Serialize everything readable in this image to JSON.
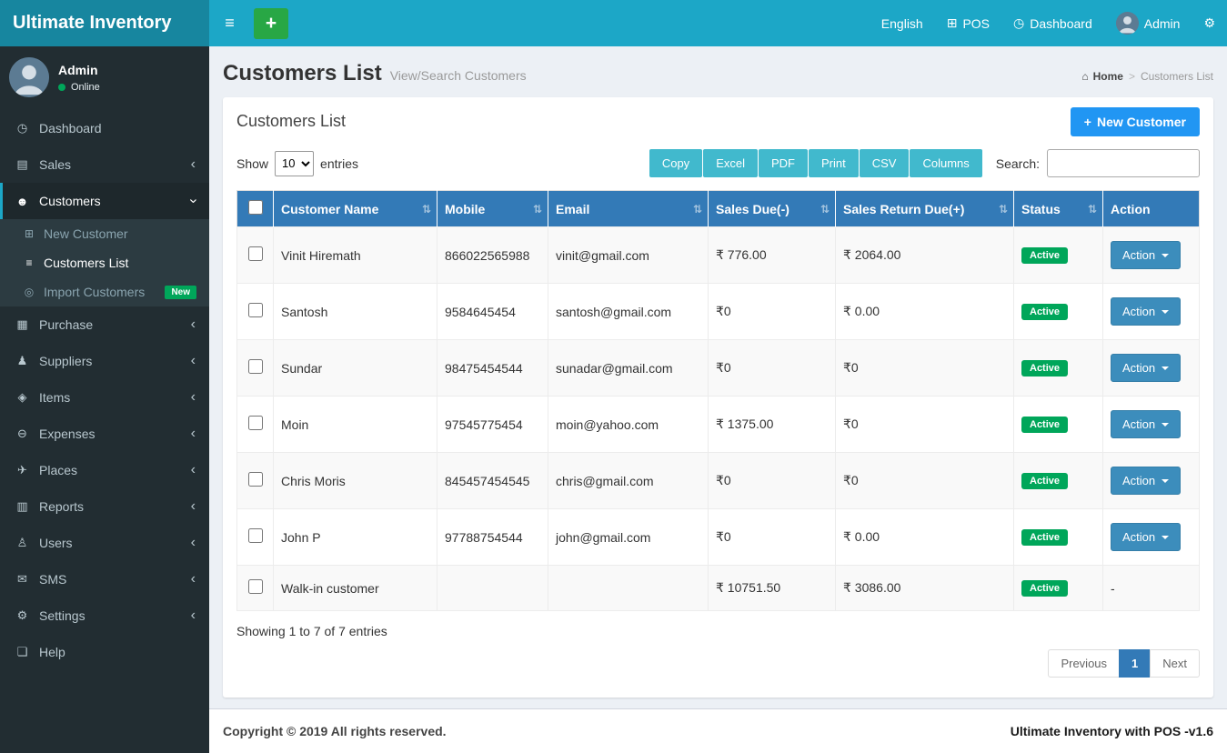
{
  "brand": {
    "title": "Ultimate Inventory"
  },
  "topbar": {
    "language": "English",
    "pos_label": "POS",
    "dashboard_label": "Dashboard",
    "user_name": "Admin",
    "icons": {
      "hamburger": "≡",
      "plus": "+",
      "pos": "⊞",
      "dashboard": "◷",
      "gears": "⚙"
    }
  },
  "sidebar": {
    "user": {
      "name": "Admin",
      "status": "Online"
    },
    "items": [
      {
        "label": "Dashboard",
        "icon": "◷",
        "chevron": ""
      },
      {
        "label": "Sales",
        "icon": "▤",
        "chevron": "‹"
      },
      {
        "label": "Customers",
        "icon": "☻",
        "chevron": "‹"
      },
      {
        "label": "Purchase",
        "icon": "▦",
        "chevron": "‹"
      },
      {
        "label": "Suppliers",
        "icon": "♟",
        "chevron": "‹"
      },
      {
        "label": "Items",
        "icon": "◈",
        "chevron": "‹"
      },
      {
        "label": "Expenses",
        "icon": "⊖",
        "chevron": "‹"
      },
      {
        "label": "Places",
        "icon": "✈",
        "chevron": "‹"
      },
      {
        "label": "Reports",
        "icon": "▥",
        "chevron": "‹"
      },
      {
        "label": "Users",
        "icon": "♙",
        "chevron": "‹"
      },
      {
        "label": "SMS",
        "icon": "✉",
        "chevron": "‹"
      },
      {
        "label": "Settings",
        "icon": "⚙",
        "chevron": "‹"
      },
      {
        "label": "Help",
        "icon": "❏",
        "chevron": ""
      }
    ],
    "customers_submenu": [
      {
        "label": "New Customer",
        "icon": "⊞",
        "badge": ""
      },
      {
        "label": "Customers List",
        "icon": "≡",
        "badge": ""
      },
      {
        "label": "Import Customers",
        "icon": "◎",
        "badge": "New"
      }
    ]
  },
  "page": {
    "title": "Customers List",
    "subtitle": "View/Search Customers",
    "breadcrumb": {
      "home_icon": "⌂",
      "home": "Home",
      "separator": ">",
      "current": "Customers List"
    }
  },
  "box": {
    "title": "Customers List",
    "new_customer_plus": "+",
    "new_customer_label": "New Customer",
    "show_label": "Show",
    "page_length": "10",
    "entries_label": "entries",
    "export_buttons": [
      "Copy",
      "Excel",
      "PDF",
      "Print",
      "CSV",
      "Columns"
    ],
    "search_label": "Search:",
    "search_value": ""
  },
  "table": {
    "sort_icon": "⇅",
    "headers": [
      "Customer Name",
      "Mobile",
      "Email",
      "Sales Due(-)",
      "Sales Return Due(+)",
      "Status",
      "Action"
    ],
    "rows": [
      {
        "name": "Vinit Hiremath",
        "mobile": "866022565988",
        "email": "vinit@gmail.com",
        "sales_due": "₹ 776.00",
        "sales_return_due": "₹ 2064.00",
        "status": "Active",
        "action": "Action"
      },
      {
        "name": "Santosh",
        "mobile": "9584645454",
        "email": "santosh@gmail.com",
        "sales_due": "₹0",
        "sales_return_due": "₹ 0.00",
        "status": "Active",
        "action": "Action"
      },
      {
        "name": "Sundar",
        "mobile": "98475454544",
        "email": "sunadar@gmail.com",
        "sales_due": "₹0",
        "sales_return_due": "₹0",
        "status": "Active",
        "action": "Action"
      },
      {
        "name": "Moin",
        "mobile": "97545775454",
        "email": "moin@yahoo.com",
        "sales_due": "₹ 1375.00",
        "sales_return_due": "₹0",
        "status": "Active",
        "action": "Action"
      },
      {
        "name": "Chris Moris",
        "mobile": "845457454545",
        "email": "chris@gmail.com",
        "sales_due": "₹0",
        "sales_return_due": "₹0",
        "status": "Active",
        "action": "Action"
      },
      {
        "name": "John P",
        "mobile": "97788754544",
        "email": "john@gmail.com",
        "sales_due": "₹0",
        "sales_return_due": "₹ 0.00",
        "status": "Active",
        "action": "Action"
      },
      {
        "name": "Walk-in customer",
        "mobile": "",
        "email": "",
        "sales_due": "₹ 10751.50",
        "sales_return_due": "₹ 3086.00",
        "status": "Active",
        "action": "-"
      }
    ],
    "summary": "Showing 1 to 7 of 7 entries"
  },
  "pagination": {
    "previous": "Previous",
    "current": "1",
    "next": "Next"
  },
  "footer": {
    "copyright": "Copyright © 2019 All rights reserved.",
    "version": "Ultimate Inventory with POS -v1.6"
  },
  "colors": {
    "navbar_teal": "#1ca7c7",
    "brand_teal": "#17869f",
    "sidebar_dark": "#222d32",
    "submenu_dark": "#2c3b41",
    "table_header_blue": "#337ab7",
    "success_green": "#00a65a",
    "action_blue": "#3c8dbc",
    "export_teal": "#41b9cd",
    "new_customer_blue": "#2196f3",
    "content_bg": "#ecf0f5"
  }
}
